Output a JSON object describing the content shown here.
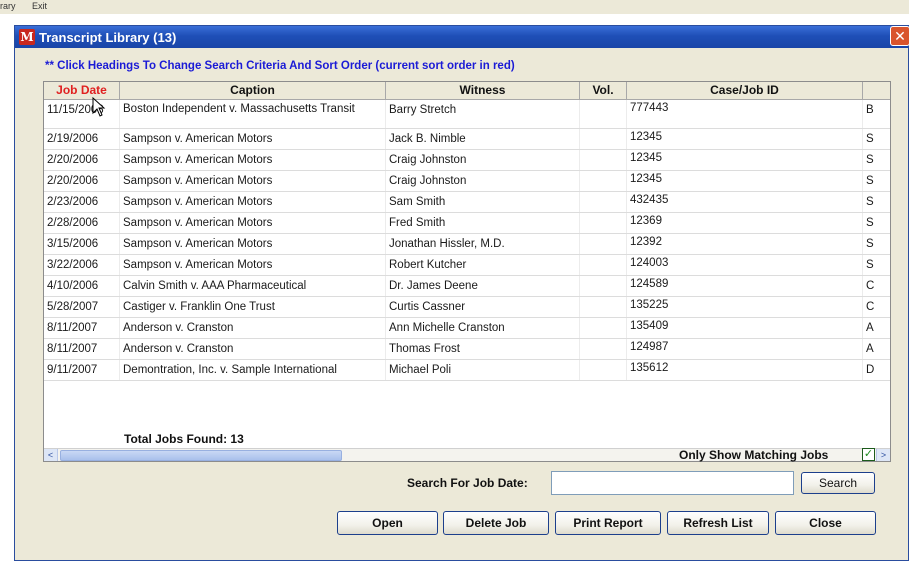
{
  "app_menu": {
    "items": [
      "rary",
      "Exit"
    ]
  },
  "window": {
    "icon_letter": "M",
    "title": "Transcript Library (13)",
    "close_glyph": "✕"
  },
  "hint": "** Click Headings To Change Search Criteria And Sort Order (current sort order in red)",
  "table": {
    "columns": [
      "Job Date",
      "Caption",
      "Witness",
      "Vol.",
      "Case/Job ID",
      ""
    ],
    "sorted_column": "Job Date",
    "rows": [
      [
        "11/15/2003",
        "Boston Independent v. Massachusetts Transit",
        "Barry Stretch",
        "",
        "777443",
        "B"
      ],
      [
        "2/19/2006",
        "Sampson v. American Motors",
        "Jack B. Nimble",
        "",
        "12345",
        "S"
      ],
      [
        "2/20/2006",
        "Sampson v. American Motors",
        "Craig Johnston",
        "",
        "12345",
        "S"
      ],
      [
        "2/20/2006",
        "Sampson v. American Motors",
        "Craig Johnston",
        "",
        "12345",
        "S"
      ],
      [
        "2/23/2006",
        "Sampson v. American Motors",
        "Sam Smith",
        "",
        "432435",
        "S"
      ],
      [
        "2/28/2006",
        "Sampson v. American Motors",
        "Fred Smith",
        "",
        "12369",
        "S"
      ],
      [
        "3/15/2006",
        "Sampson v. American Motors",
        "Jonathan Hissler, M.D.",
        "",
        "12392",
        "S"
      ],
      [
        "3/22/2006",
        "Sampson v. American Motors",
        "Robert Kutcher",
        "",
        "124003",
        "S"
      ],
      [
        "4/10/2006",
        "Calvin Smith v. AAA Pharmaceutical",
        "Dr. James Deene",
        "",
        "124589",
        "C"
      ],
      [
        "5/28/2007",
        "Castiger v. Franklin One Trust",
        "Curtis Cassner",
        "",
        "135225",
        "C"
      ],
      [
        "8/11/2007",
        "Anderson v. Cranston",
        "Ann Michelle Cranston",
        "",
        "135409",
        "A"
      ],
      [
        "8/11/2007",
        "Anderson v. Cranston",
        "Thomas Frost",
        "",
        "124987",
        "A"
      ],
      [
        "9/11/2007",
        "Demontration, Inc. v. Sample International",
        "Michael Poli",
        "",
        "135612",
        "D"
      ]
    ]
  },
  "total_label": "Total Jobs Found: 13",
  "only_matching": {
    "label": "Only Show Matching Jobs",
    "checked": true,
    "check_glyph": "✓"
  },
  "search": {
    "label": "Search For Job Date:",
    "value": "",
    "button": "Search"
  },
  "buttons": {
    "open": "Open",
    "delete": "Delete Job",
    "print": "Print Report",
    "refresh": "Refresh List",
    "close": "Close"
  },
  "scroll": {
    "left_glyph": "<",
    "right_glyph": ">"
  },
  "colors": {
    "title_bar": "#1f4fb7",
    "sorted_header": "#e02020",
    "hint_text": "#1b1bd6",
    "window_bg": "#ece9d8",
    "button_border": "#1c3f8c",
    "checkbox_check": "#1c8a1c"
  }
}
